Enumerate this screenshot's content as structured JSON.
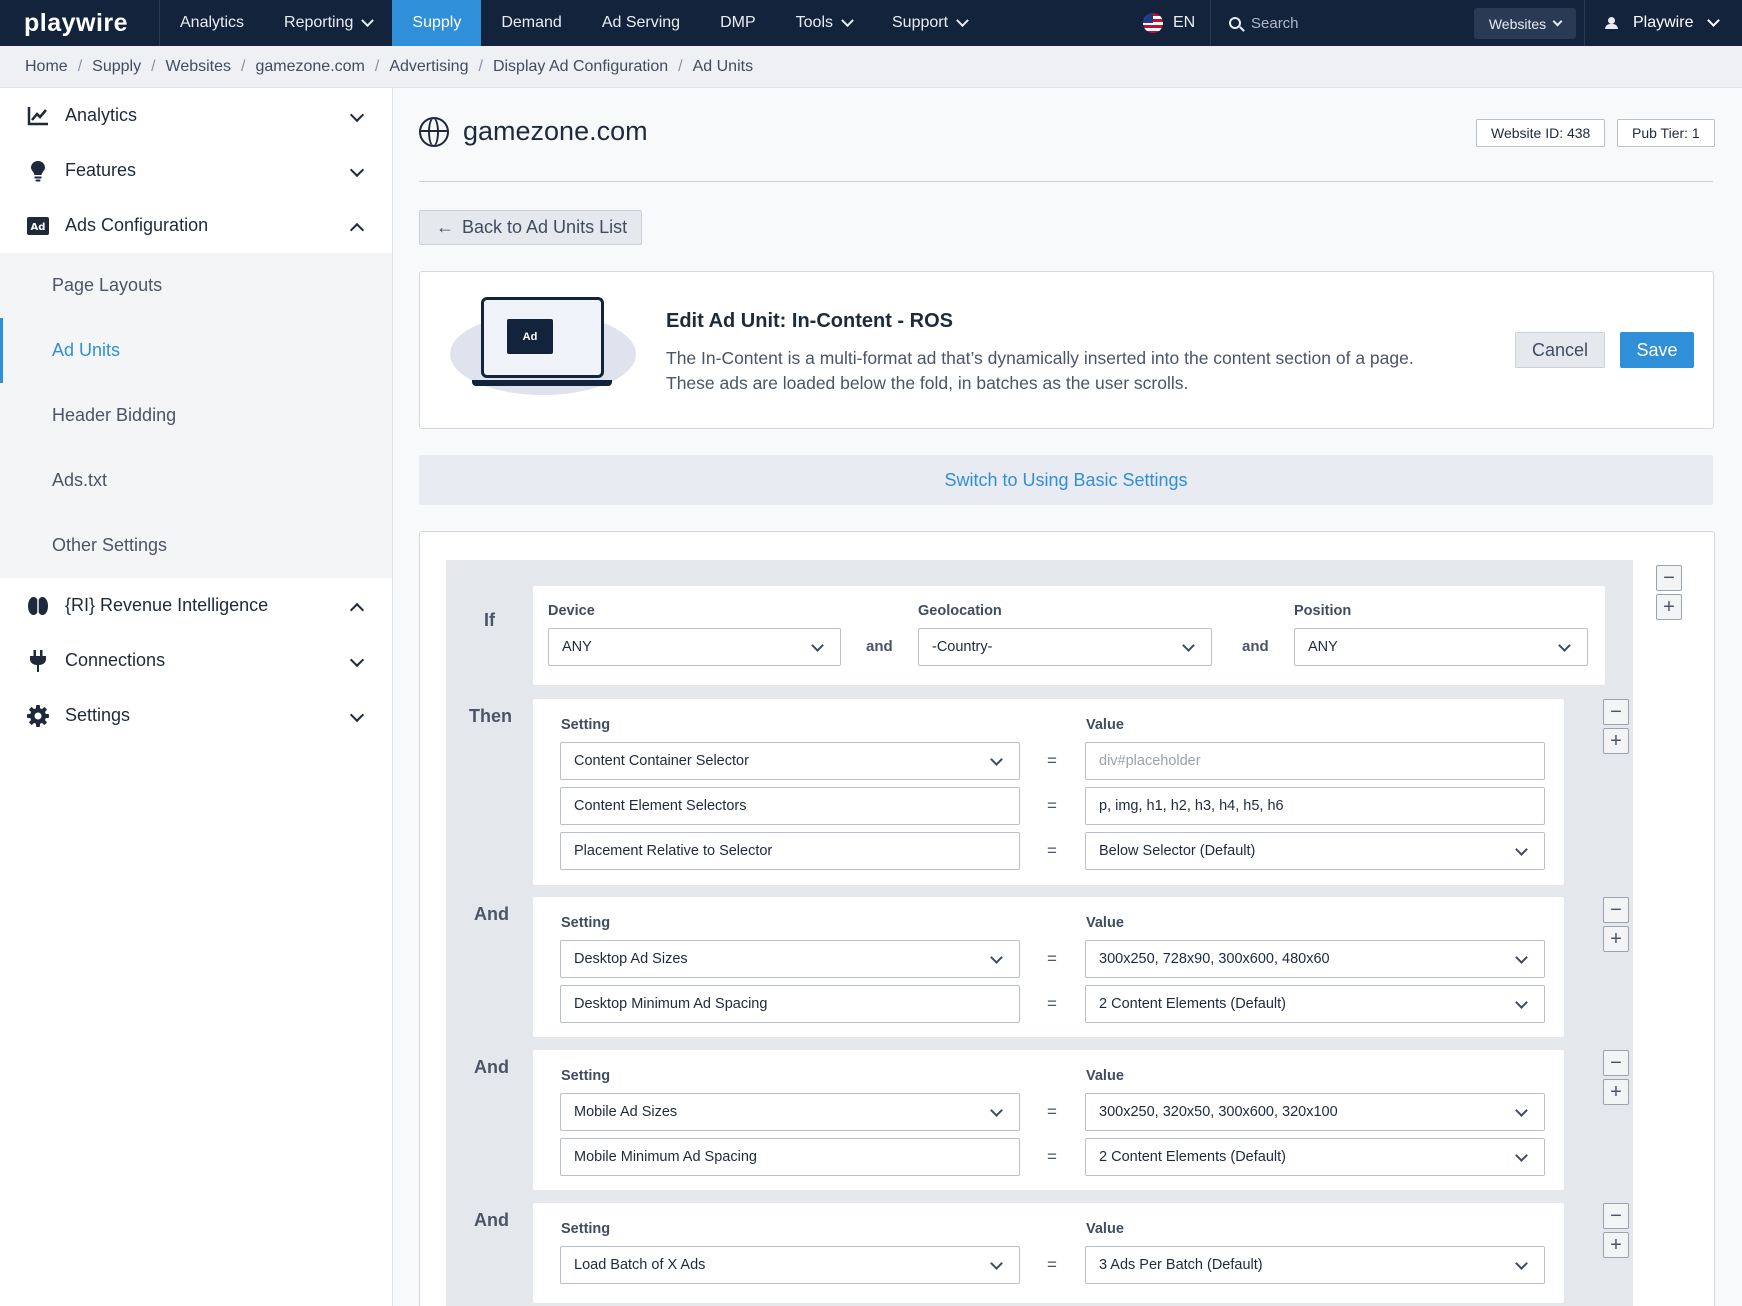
{
  "topnav": {
    "logo": "playwire",
    "items": [
      {
        "label": "Analytics"
      },
      {
        "label": "Reporting"
      },
      {
        "label": "Supply"
      },
      {
        "label": "Demand"
      },
      {
        "label": "Ad Serving"
      },
      {
        "label": "DMP"
      },
      {
        "label": "Tools"
      },
      {
        "label": "Support"
      }
    ],
    "lang": "EN",
    "search_placeholder": "Search",
    "websites": "Websites",
    "user": "Playwire"
  },
  "breadcrumb": [
    "Home",
    "Supply",
    "Websites",
    "gamezone.com",
    "Advertising",
    "Display Ad Configuration",
    "Ad Units"
  ],
  "sidebar": {
    "items": [
      {
        "label": "Analytics"
      },
      {
        "label": "Features"
      },
      {
        "label": "Ads Configuration"
      },
      {
        "label": "{RI} Revenue Intelligence"
      },
      {
        "label": "Connections"
      },
      {
        "label": "Settings"
      }
    ],
    "sub_items": [
      {
        "label": "Page Layouts"
      },
      {
        "label": "Ad Units"
      },
      {
        "label": "Header Bidding"
      },
      {
        "label": "Ads.txt"
      },
      {
        "label": "Other Settings"
      }
    ]
  },
  "main": {
    "site_title": "gamezone.com",
    "website_id": "Website ID: 438",
    "pub_tier": "Pub Tier: 1",
    "back_label": "Back to Ad Units List",
    "edit": {
      "ad_badge": "Ad",
      "title": "Edit Ad Unit: In-Content - ROS",
      "desc_line1": "The In-Content is a multi-format ad that’s dynamically inserted into the content section of a page.",
      "desc_line2": "These ads are loaded below the fold, in batches as the user scrolls.",
      "cancel": "Cancel",
      "save": "Save"
    },
    "switch_label": "Switch to Using Basic Settings",
    "rules": {
      "if_label": "If",
      "then_label": "Then",
      "and_label": "And",
      "and_inline": "and",
      "eq": "=",
      "setting_label": "Setting",
      "value_label": "Value",
      "device_label": "Device",
      "device_value": "ANY",
      "geo_label": "Geolocation",
      "geo_value": "-Country-",
      "position_label": "Position",
      "position_value": "ANY",
      "then_rows": [
        {
          "setting": "Content Container Selector",
          "value": "div#placeholder"
        },
        {
          "setting": "Content Element Selectors",
          "value": "p, img, h1, h2, h3, h4, h5, h6"
        },
        {
          "setting": "Placement Relative to Selector",
          "value": "Below Selector (Default)"
        }
      ],
      "and1_rows": [
        {
          "setting": "Desktop Ad Sizes",
          "value": "300x250, 728x90, 300x600, 480x60"
        },
        {
          "setting": "Desktop Minimum Ad Spacing",
          "value": "2 Content Elements (Default)"
        }
      ],
      "and2_rows": [
        {
          "setting": "Mobile Ad Sizes",
          "value": "300x250, 320x50, 300x600, 320x100"
        },
        {
          "setting": "Mobile Minimum Ad Spacing",
          "value": "2 Content Elements (Default)"
        }
      ],
      "and3_rows": [
        {
          "setting": "Load Batch of X Ads",
          "value": "3 Ads Per Batch (Default)"
        }
      ]
    }
  }
}
